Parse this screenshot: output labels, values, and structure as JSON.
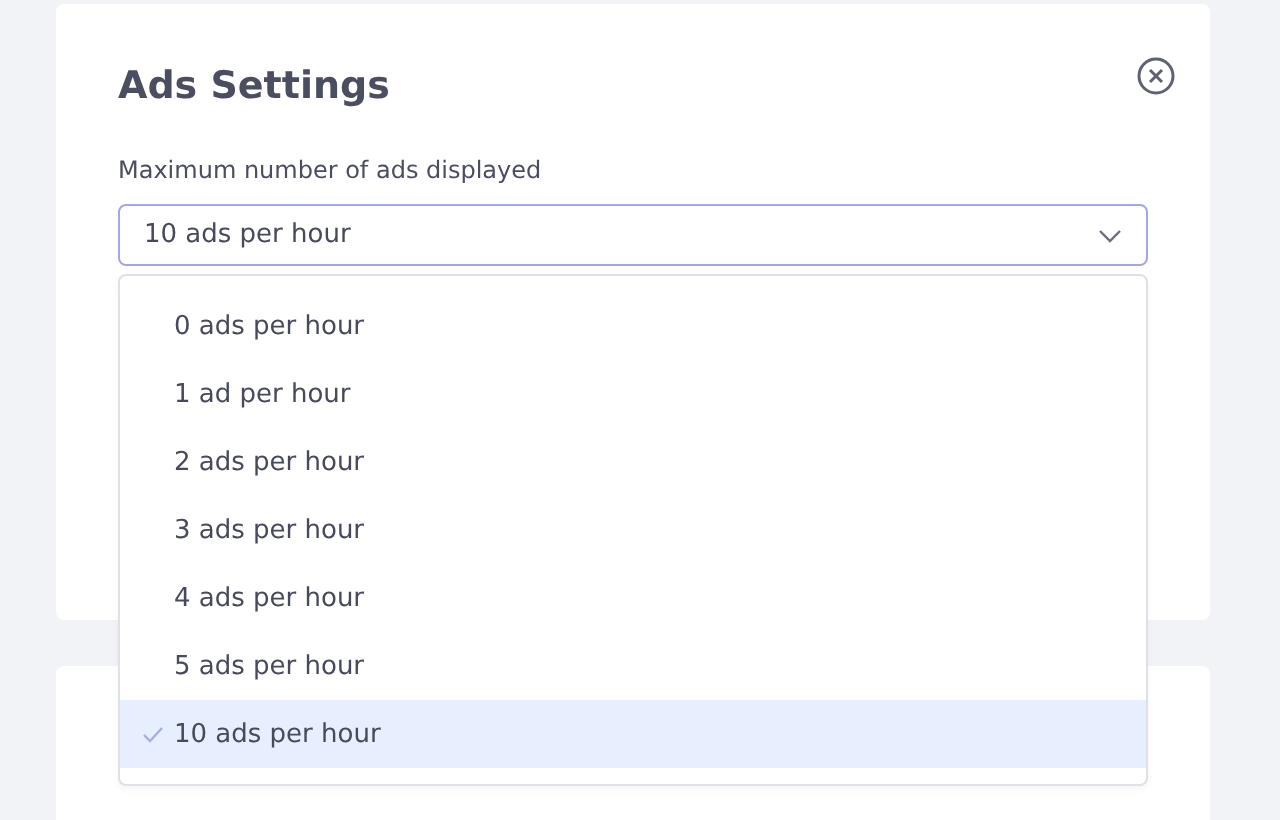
{
  "dialog": {
    "title": "Ads Settings"
  },
  "field": {
    "label": "Maximum number of ads displayed",
    "value": "10 ads per hour",
    "expanded": true
  },
  "options": [
    {
      "label": "0 ads per hour",
      "selected": false
    },
    {
      "label": "1 ad per hour",
      "selected": false
    },
    {
      "label": "2 ads per hour",
      "selected": false
    },
    {
      "label": "3 ads per hour",
      "selected": false
    },
    {
      "label": "4 ads per hour",
      "selected": false
    },
    {
      "label": "5 ads per hour",
      "selected": false
    },
    {
      "label": "10 ads per hour",
      "selected": true
    }
  ]
}
